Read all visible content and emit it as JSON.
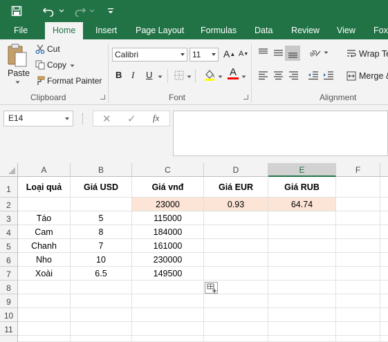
{
  "quick_access": {
    "save_icon": "save-icon",
    "undo_icon": "undo-icon",
    "redo_icon": "redo-icon",
    "customize_icon": "customize-qat-icon"
  },
  "tabs": [
    "File",
    "Home",
    "Insert",
    "Page Layout",
    "Formulas",
    "Data",
    "Review",
    "View",
    "Foxit"
  ],
  "active_tab": "Home",
  "clipboard": {
    "paste": "Paste",
    "cut": "Cut",
    "copy": "Copy",
    "format_painter": "Format Painter",
    "group_label": "Clipboard"
  },
  "font": {
    "family": "Calibri",
    "size": "11",
    "bold": "B",
    "italic": "I",
    "underline": "U",
    "font_color_glyph": "A",
    "group_label": "Font",
    "fill_color": "#ffff00",
    "font_color": "#ff0000"
  },
  "alignment": {
    "wrap_text": "Wrap Te",
    "merge": "Merge &",
    "group_label": "Alignment"
  },
  "formula_bar": {
    "name_box": "E14",
    "fx": "fx",
    "cancel_glyph": "✕",
    "enter_glyph": "✓",
    "value": ""
  },
  "sheet": {
    "columns": [
      "A",
      "B",
      "C",
      "D",
      "E",
      "F"
    ],
    "selected_column": "E",
    "rows": [
      "1",
      "2",
      "3",
      "4",
      "5",
      "6",
      "7",
      "8",
      "9",
      "10",
      "11"
    ],
    "header_row": [
      "Loại quả",
      "Giá USD",
      "Giá vnđ",
      "Giá EUR",
      "Giá RUB"
    ],
    "rate_row": [
      "",
      "",
      "23000",
      "0.93",
      "64.74"
    ],
    "data_rows": [
      [
        "Táo",
        "5",
        "115000"
      ],
      [
        "Cam",
        "8",
        "184000"
      ],
      [
        "Chanh",
        "7",
        "161000"
      ],
      [
        "Nho",
        "10",
        "230000"
      ],
      [
        "Xoài",
        "6.5",
        "149500"
      ]
    ],
    "highlight_color": "#fce4d6"
  },
  "colors": {
    "brand": "#217346"
  }
}
